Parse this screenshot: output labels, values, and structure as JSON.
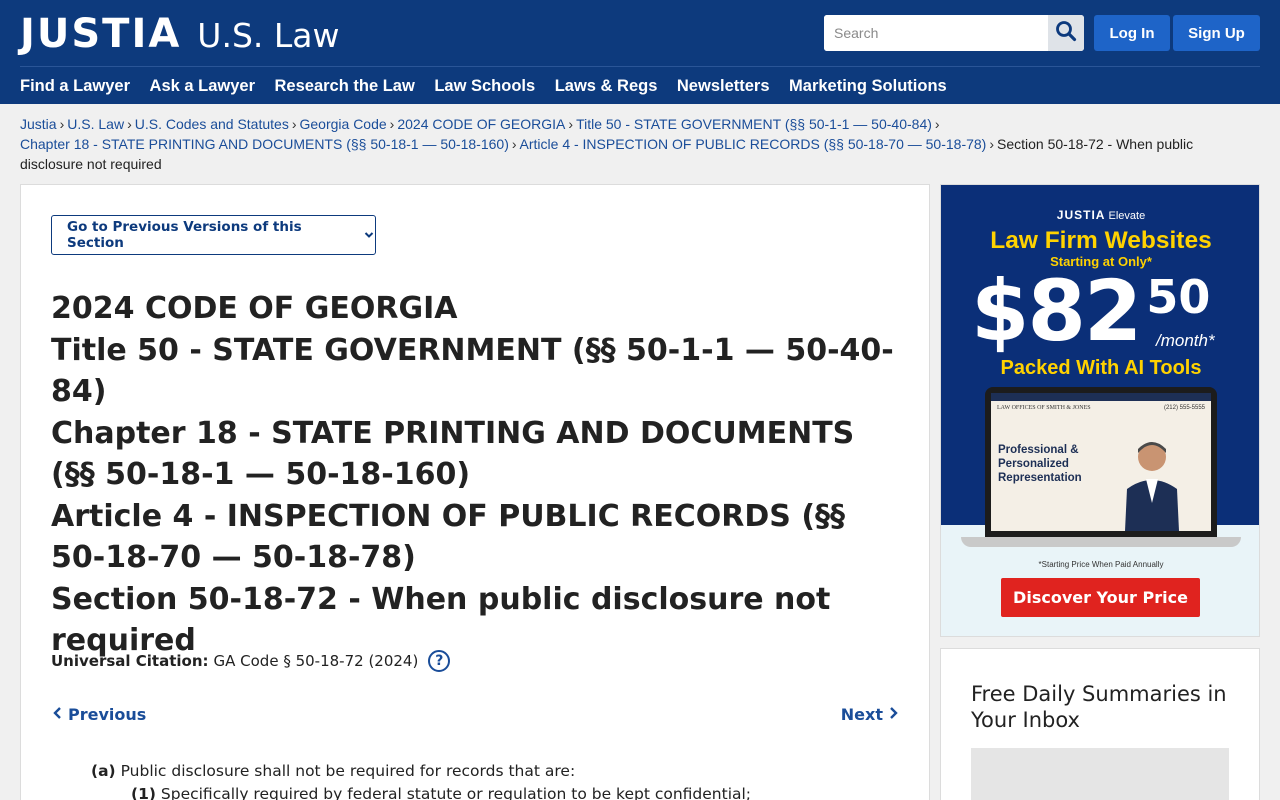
{
  "header": {
    "logo_main": "JUSTIA",
    "logo_sub": "U.S. Law",
    "search_placeholder": "Search",
    "login_label": "Log In",
    "signup_label": "Sign Up",
    "nav": [
      "Find a Lawyer",
      "Ask a Lawyer",
      "Research the Law",
      "Law Schools",
      "Laws & Regs",
      "Newsletters",
      "Marketing Solutions"
    ]
  },
  "breadcrumbs": {
    "links": [
      "Justia",
      "U.S. Law",
      "U.S. Codes and Statutes",
      "Georgia Code",
      "2024 CODE OF GEORGIA",
      "Title 50 - STATE GOVERNMENT (§§ 50-1-1 — 50-40-84)",
      "Chapter 18 - STATE PRINTING AND DOCUMENTS (§§ 50-18-1 — 50-18-160)",
      "Article 4 - INSPECTION OF PUBLIC RECORDS (§§ 50-18-70 — 50-18-78)"
    ],
    "current": "Section 50-18-72 - When public disclosure not required",
    "separator": "›"
  },
  "main": {
    "prev_versions_label": "Go to Previous Versions of this Section",
    "title_lines": [
      "2024 CODE OF GEORGIA",
      "Title 50 - STATE GOVERNMENT (§§ 50-1-1 — 50-40-84)",
      "Chapter 18 - STATE PRINTING AND DOCUMENTS (§§ 50-18-1 — 50-18-160)",
      "Article 4 - INSPECTION OF PUBLIC RECORDS (§§ 50-18-70 — 50-18-78)",
      "Section 50-18-72 - When public disclosure not required"
    ],
    "citation_label": "Universal Citation:",
    "citation_value": "GA Code § 50-18-72 (2024)",
    "help_glyph": "?",
    "previous_label": "Previous",
    "next_label": "Next",
    "body": [
      {
        "marker": "(a)",
        "text": "Public disclosure shall not be required for records that are:"
      },
      {
        "marker": "(1)",
        "text": "Specifically required by federal statute or regulation to be kept confidential;"
      }
    ]
  },
  "ad": {
    "brand": "JUSTIA",
    "brand_sub": "Elevate",
    "headline": "Law Firm Websites",
    "starting": "Starting at Only*",
    "price_main": "$82",
    "price_cents": "50",
    "price_period": "/month*",
    "packed": "Packed With AI Tools",
    "screen_firm": "LAW OFFICES OF SMITH & JONES",
    "screen_phone": "(212) 555-5555",
    "screen_text_lines": [
      "Professional &",
      "Personalized",
      "Representation"
    ],
    "note": "*Starting Price When Paid Annually",
    "cta": "Discover Your Price",
    "colors": {
      "bg": "#0b2f78",
      "accent": "#ffd200",
      "cta": "#e0231f"
    }
  },
  "newsletter": {
    "title": "Free Daily Summaries in Your Inbox"
  },
  "colors": {
    "brand": "#0d3a7d",
    "button": "#1e64c8",
    "link": "#1a4d99"
  }
}
